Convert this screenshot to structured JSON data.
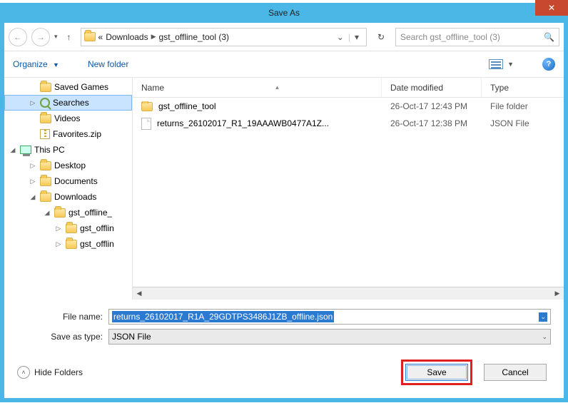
{
  "title": "Save As",
  "breadcrumb": {
    "prefix": "«",
    "seg1": "Downloads",
    "seg2": "gst_offline_tool (3)"
  },
  "search": {
    "placeholder": "Search gst_offline_tool (3)"
  },
  "toolbar": {
    "organize": "Organize",
    "newfolder": "New folder"
  },
  "columns": {
    "name": "Name",
    "date": "Date modified",
    "type": "Type"
  },
  "rows": [
    {
      "icon": "folder",
      "name": "gst_offline_tool",
      "date": "26-Oct-17 12:43 PM",
      "type": "File folder"
    },
    {
      "icon": "file",
      "name": "returns_26102017_R1_19AAAWB0477A1Z...",
      "date": "26-Oct-17 12:38 PM",
      "type": "JSON File"
    }
  ],
  "sidebar": [
    {
      "depth": 1,
      "icon": "folder",
      "label": "Saved Games",
      "expander": ""
    },
    {
      "depth": 1,
      "icon": "search",
      "label": "Searches",
      "expander": "▷",
      "selected": true
    },
    {
      "depth": 1,
      "icon": "folder",
      "label": "Videos",
      "expander": ""
    },
    {
      "depth": 1,
      "icon": "zip",
      "label": "Favorites.zip",
      "expander": ""
    },
    {
      "depth": 0,
      "icon": "pc",
      "label": "This PC",
      "expander": "◢"
    },
    {
      "depth": 1,
      "icon": "folder",
      "label": "Desktop",
      "expander": "▷"
    },
    {
      "depth": 1,
      "icon": "folder",
      "label": "Documents",
      "expander": "▷"
    },
    {
      "depth": 1,
      "icon": "folder",
      "label": "Downloads",
      "expander": "◢"
    },
    {
      "depth": 2,
      "icon": "folder",
      "label": "gst_offline_",
      "expander": "◢"
    },
    {
      "depth": 3,
      "icon": "folder",
      "label": "gst_offlin",
      "expander": "▷"
    },
    {
      "depth": 3,
      "icon": "folder",
      "label": "gst_offlin",
      "expander": "▷"
    }
  ],
  "fields": {
    "filename_label": "File name:",
    "filename_value": "returns_26102017_R1A_29GDTPS3486J1ZB_offline.json",
    "type_label": "Save as type:",
    "type_value": "JSON File"
  },
  "footer": {
    "hide": "Hide Folders",
    "save": "Save",
    "cancel": "Cancel"
  }
}
